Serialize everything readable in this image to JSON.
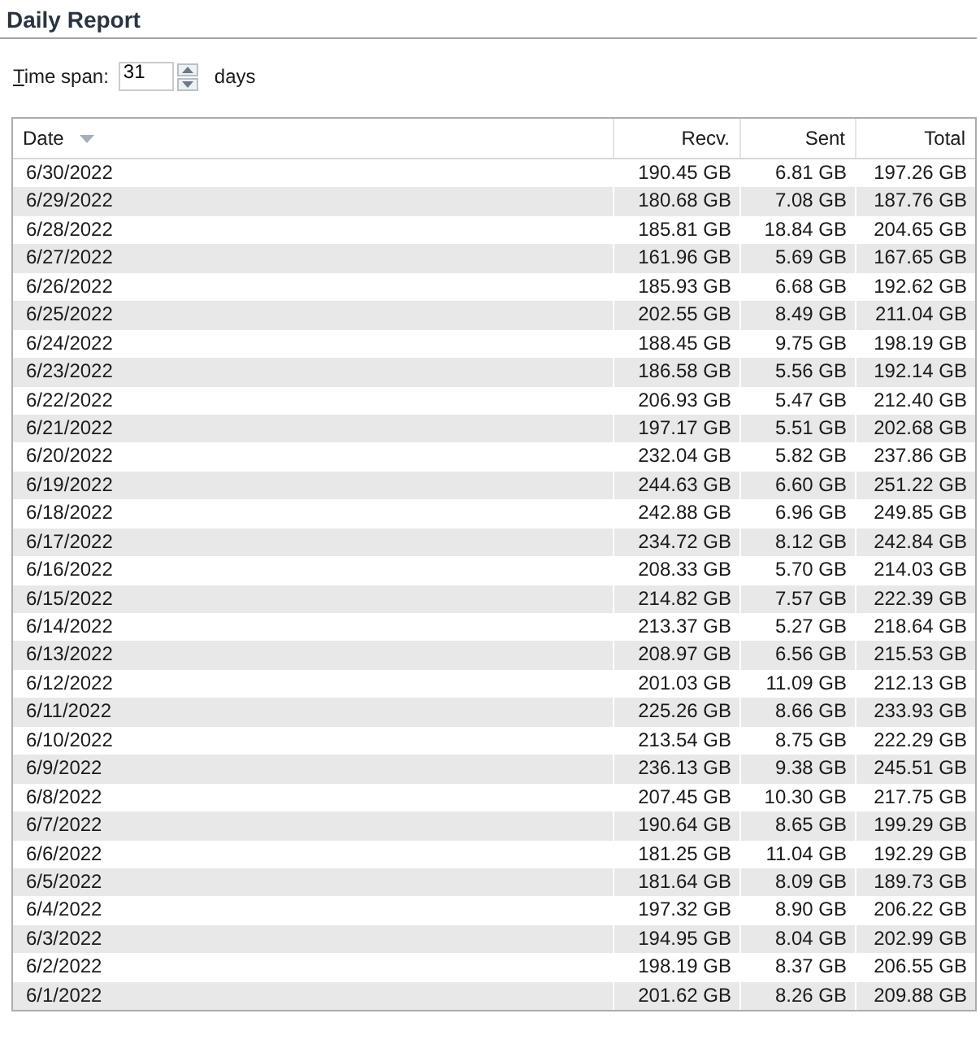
{
  "title": "Daily Report",
  "time_span": {
    "label": "Time span:",
    "value": "31",
    "unit": "days"
  },
  "table": {
    "columns": [
      {
        "label": "Date",
        "sorted": true
      },
      {
        "label": "Recv.",
        "sorted": false
      },
      {
        "label": "Sent",
        "sorted": false
      },
      {
        "label": "Total",
        "sorted": false
      }
    ],
    "rows": [
      [
        "6/30/2022",
        "190.45 GB",
        "6.81 GB",
        "197.26 GB"
      ],
      [
        "6/29/2022",
        "180.68 GB",
        "7.08 GB",
        "187.76 GB"
      ],
      [
        "6/28/2022",
        "185.81 GB",
        "18.84 GB",
        "204.65 GB"
      ],
      [
        "6/27/2022",
        "161.96 GB",
        "5.69 GB",
        "167.65 GB"
      ],
      [
        "6/26/2022",
        "185.93 GB",
        "6.68 GB",
        "192.62 GB"
      ],
      [
        "6/25/2022",
        "202.55 GB",
        "8.49 GB",
        "211.04 GB"
      ],
      [
        "6/24/2022",
        "188.45 GB",
        "9.75 GB",
        "198.19 GB"
      ],
      [
        "6/23/2022",
        "186.58 GB",
        "5.56 GB",
        "192.14 GB"
      ],
      [
        "6/22/2022",
        "206.93 GB",
        "5.47 GB",
        "212.40 GB"
      ],
      [
        "6/21/2022",
        "197.17 GB",
        "5.51 GB",
        "202.68 GB"
      ],
      [
        "6/20/2022",
        "232.04 GB",
        "5.82 GB",
        "237.86 GB"
      ],
      [
        "6/19/2022",
        "244.63 GB",
        "6.60 GB",
        "251.22 GB"
      ],
      [
        "6/18/2022",
        "242.88 GB",
        "6.96 GB",
        "249.85 GB"
      ],
      [
        "6/17/2022",
        "234.72 GB",
        "8.12 GB",
        "242.84 GB"
      ],
      [
        "6/16/2022",
        "208.33 GB",
        "5.70 GB",
        "214.03 GB"
      ],
      [
        "6/15/2022",
        "214.82 GB",
        "7.57 GB",
        "222.39 GB"
      ],
      [
        "6/14/2022",
        "213.37 GB",
        "5.27 GB",
        "218.64 GB"
      ],
      [
        "6/13/2022",
        "208.97 GB",
        "6.56 GB",
        "215.53 GB"
      ],
      [
        "6/12/2022",
        "201.03 GB",
        "11.09 GB",
        "212.13 GB"
      ],
      [
        "6/11/2022",
        "225.26 GB",
        "8.66 GB",
        "233.93 GB"
      ],
      [
        "6/10/2022",
        "213.54 GB",
        "8.75 GB",
        "222.29 GB"
      ],
      [
        "6/9/2022",
        "236.13 GB",
        "9.38 GB",
        "245.51 GB"
      ],
      [
        "6/8/2022",
        "207.45 GB",
        "10.30 GB",
        "217.75 GB"
      ],
      [
        "6/7/2022",
        "190.64 GB",
        "8.65 GB",
        "199.29 GB"
      ],
      [
        "6/6/2022",
        "181.25 GB",
        "11.04 GB",
        "192.29 GB"
      ],
      [
        "6/5/2022",
        "181.64 GB",
        "8.09 GB",
        "189.73 GB"
      ],
      [
        "6/4/2022",
        "197.32 GB",
        "8.90 GB",
        "206.22 GB"
      ],
      [
        "6/3/2022",
        "194.95 GB",
        "8.04 GB",
        "202.99 GB"
      ],
      [
        "6/2/2022",
        "198.19 GB",
        "8.37 GB",
        "206.55 GB"
      ],
      [
        "6/1/2022",
        "201.62 GB",
        "8.26 GB",
        "209.88 GB"
      ]
    ]
  }
}
